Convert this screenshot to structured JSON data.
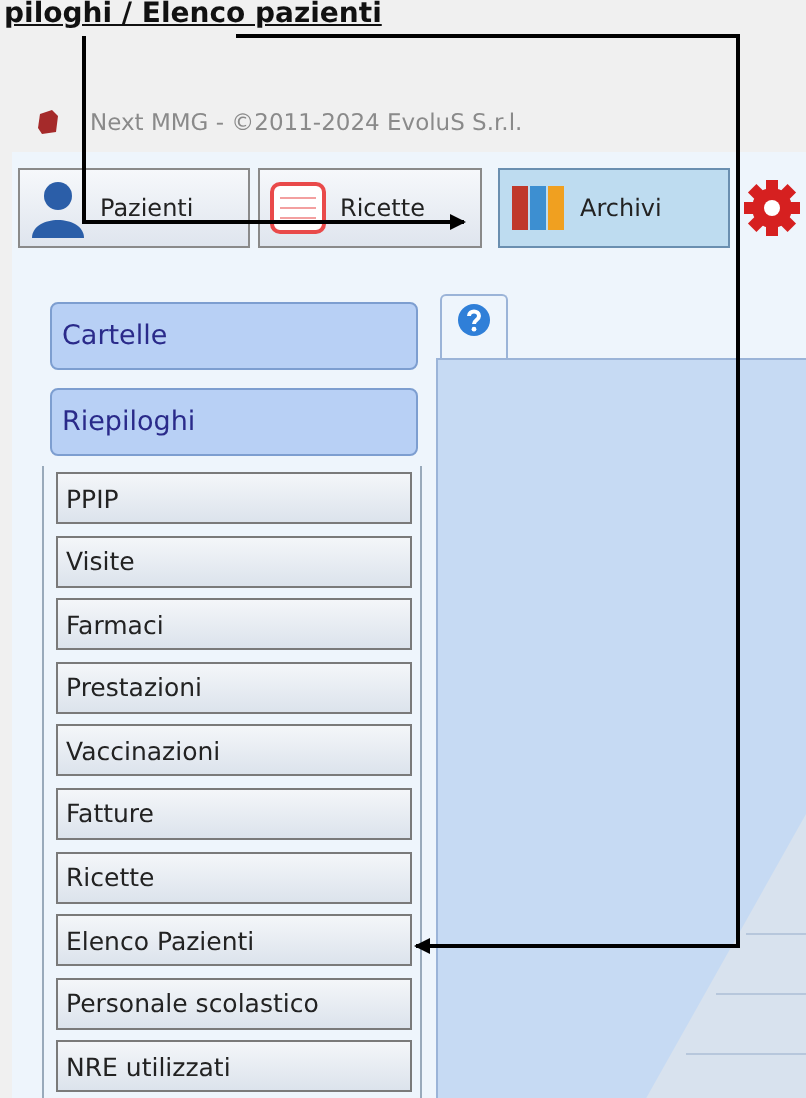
{
  "heading": "piloghi / Elenco pazienti",
  "window": {
    "title": "Next MMG - ©2011-2024 EvoluS S.r.l."
  },
  "toolbar": {
    "buttons": [
      {
        "kind": "person",
        "label": "Pazienti",
        "selected": false
      },
      {
        "kind": "prescription",
        "label": "Ricette",
        "selected": false
      },
      {
        "kind": "binders",
        "label": "Archivi",
        "selected": true
      },
      {
        "kind": "gear"
      }
    ]
  },
  "sidebar": {
    "sections": [
      {
        "label": "Cartelle"
      },
      {
        "label": "Riepiloghi"
      }
    ],
    "items": [
      "PPIP",
      "Visite",
      "Farmaci",
      "Prestazioni",
      "Vaccinazioni",
      "Fatture",
      "Ricette",
      "Elenco Pazienti",
      "Personale scolastico",
      "NRE utilizzati"
    ]
  }
}
